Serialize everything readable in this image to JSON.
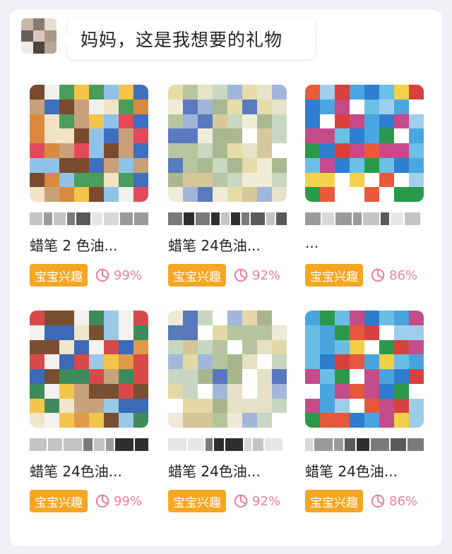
{
  "header": {
    "message": "妈妈，这是我想要的礼物"
  },
  "colors": {
    "badge": "#f6a623",
    "score": "#f07c9b"
  },
  "products": [
    {
      "line2": "蜡笔 2 色油...",
      "badge": "宝宝兴趣",
      "score": "99%",
      "palette": [
        "#e24a5c",
        "#f2c44b",
        "#4a9d5a",
        "#3f6fbf",
        "#d98a3e",
        "#f1e3c4",
        "#7a4a2e",
        "#8fc2e8",
        "#c9a07a",
        "#f0f0ec"
      ]
    },
    {
      "line2": "蜡笔 24色油...",
      "badge": "宝宝兴趣",
      "score": "92%",
      "palette": [
        "#c8d8c2",
        "#e6dca8",
        "#9fb6d8",
        "#d6c89a",
        "#aab890",
        "#f0ecd8",
        "#5a7abf",
        "#e8e2c8",
        "#b8c6a0",
        "#ffffff"
      ]
    },
    {
      "line2": "...",
      "badge": "宝宝兴趣",
      "score": "86%",
      "palette": [
        "#4aa6e0",
        "#d8403c",
        "#2f7fd0",
        "#f2d24a",
        "#6cc0e8",
        "#2a9a4a",
        "#e85a3a",
        "#9ed0ee",
        "#c64a8a",
        "#ffffff"
      ]
    },
    {
      "line2": "蜡笔 24色油...",
      "badge": "宝宝兴趣",
      "score": "99%",
      "palette": [
        "#d84a4a",
        "#f2c64a",
        "#3f8a5a",
        "#3a6ab8",
        "#e09a4a",
        "#f1e6cc",
        "#7a4e30",
        "#9ac8e6",
        "#c8a27c",
        "#f4f2ee"
      ]
    },
    {
      "line2": "蜡笔 24色油...",
      "badge": "宝宝兴趣",
      "score": "92%",
      "palette": [
        "#c6d6c0",
        "#e4d8a6",
        "#a2b8da",
        "#d4c696",
        "#a8b68e",
        "#eeead6",
        "#5878be",
        "#e6e0c6",
        "#b6c49e",
        "#ffffff"
      ]
    },
    {
      "line2": "蜡笔 24色油...",
      "badge": "宝宝兴趣",
      "score": "86%",
      "palette": [
        "#48a4de",
        "#d6423e",
        "#2d7dce",
        "#f0d048",
        "#6abee6",
        "#2c984c",
        "#e6583c",
        "#9cceec",
        "#c44c88",
        "#ffffff"
      ]
    }
  ]
}
